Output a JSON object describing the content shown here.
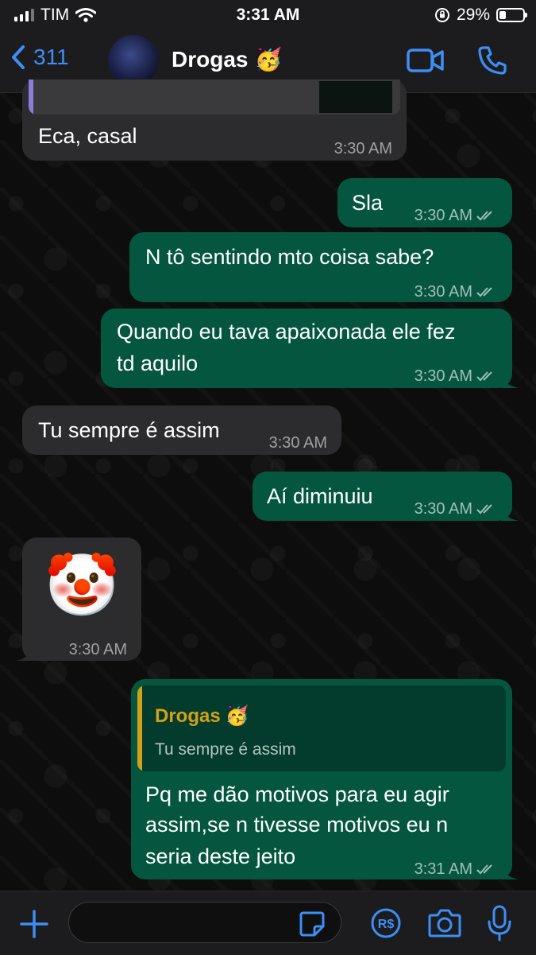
{
  "status": {
    "carrier": "TIM",
    "time": "3:31 AM",
    "battery": "29%",
    "battery_level": 0.29
  },
  "header": {
    "back_count": "311",
    "chat_name": "Drogas",
    "name_emoji": "🥳"
  },
  "messages": [
    {
      "type": "incoming",
      "text": "Eca, casal",
      "time": "3:30 AM"
    },
    {
      "type": "outgoing",
      "text": "Sla",
      "time": "3:30 AM"
    },
    {
      "type": "outgoing",
      "text": "N tô sentindo mto coisa sabe?",
      "time": "3:30 AM"
    },
    {
      "type": "outgoing",
      "line1": "Quando eu tava apaixonada ele fez",
      "line2": "td aquilo",
      "time": "3:30 AM"
    },
    {
      "type": "incoming",
      "text": "Tu sempre é assim",
      "time": "3:30 AM"
    },
    {
      "type": "outgoing",
      "text": "Aí diminuiu",
      "time": "3:30 AM"
    },
    {
      "type": "incoming",
      "emoji": "🤡",
      "time": "3:30 AM"
    },
    {
      "type": "outgoing",
      "reply_name": "Drogas",
      "reply_emoji": "🥳",
      "reply_text": "Tu sempre é assim",
      "line1": "Pq me dão motivos para eu agir",
      "line2": "assim,se n tivesse motivos eu n",
      "line3": "seria deste jeito",
      "time": "3:31 AM"
    }
  ],
  "colors": {
    "accent": "#3d8ef5",
    "outgoing": "#05563f",
    "incoming": "#2c2c2e",
    "quote_name": "#d4a017"
  },
  "icons": [
    "back-chevron-icon",
    "video-call-icon",
    "phone-icon",
    "plus-icon",
    "sticker-icon",
    "payment-icon",
    "camera-icon",
    "microphone-icon"
  ]
}
